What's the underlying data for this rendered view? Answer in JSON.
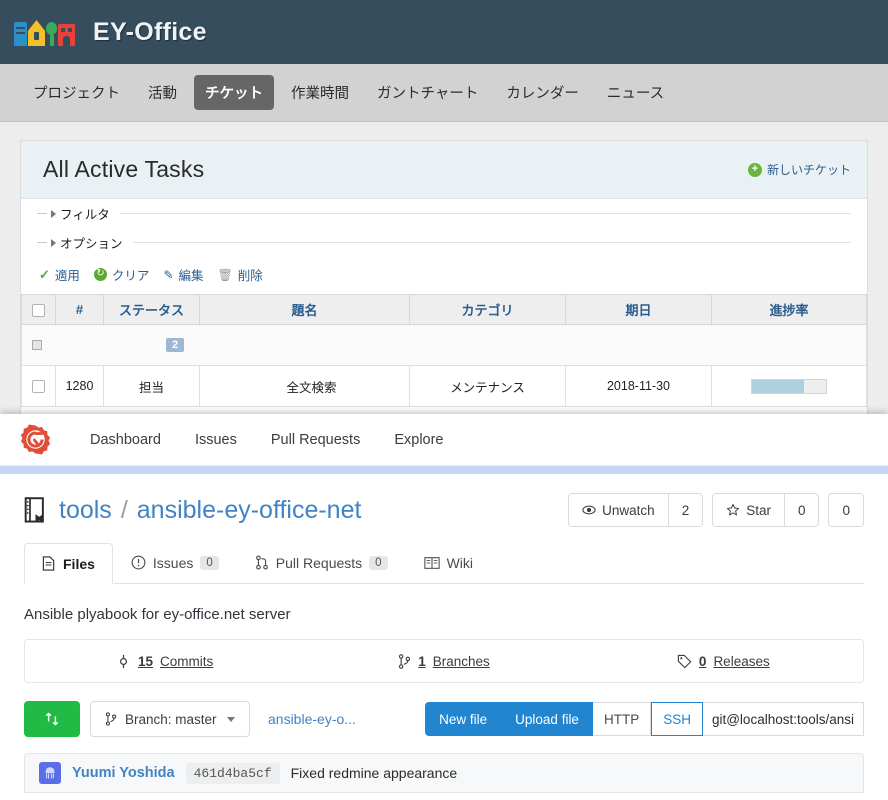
{
  "redmine": {
    "brand": "EY-Office",
    "logo_icon": "houses-logo-icon",
    "nav": [
      {
        "label": "プロジェクト",
        "active": false
      },
      {
        "label": "活動",
        "active": false
      },
      {
        "label": "チケット",
        "active": true
      },
      {
        "label": "作業時間",
        "active": false
      },
      {
        "label": "ガントチャート",
        "active": false
      },
      {
        "label": "カレンダー",
        "active": false
      },
      {
        "label": "ニュース",
        "active": false
      }
    ],
    "page_title": "All Active Tasks",
    "new_ticket_label": "新しいチケット",
    "new_ticket_icon": "plus-circle-icon",
    "collapsibles": [
      {
        "label": "フィルタ"
      },
      {
        "label": "オプション"
      }
    ],
    "tools": [
      {
        "label": "適用",
        "icon": "check-icon"
      },
      {
        "label": "クリア",
        "icon": "reload-icon"
      },
      {
        "label": "編集",
        "icon": "pencil-icon"
      },
      {
        "label": "削除",
        "icon": "trash-icon"
      }
    ],
    "table": {
      "headers": [
        "#",
        "ステータス",
        "題名",
        "カテゴリ",
        "期日",
        "進捗率"
      ],
      "group_row": {
        "name_redacted": true,
        "count": "2"
      },
      "rows": [
        {
          "id": "1280",
          "status": "担当",
          "subject": "全文検索",
          "category": "メンテナンス",
          "due_date": "2018-11-30",
          "progress_percent": 70
        }
      ]
    }
  },
  "gitea": {
    "logo_icon": "gitea-gear-icon",
    "nav": [
      {
        "label": "Dashboard"
      },
      {
        "label": "Issues"
      },
      {
        "label": "Pull Requests"
      },
      {
        "label": "Explore"
      }
    ],
    "repo": {
      "icon": "repo-book-icon",
      "owner": "tools",
      "separator": "/",
      "name": "ansible-ey-office-net",
      "watch": {
        "label": "Unwatch",
        "icon": "eye-icon",
        "count": "2"
      },
      "star": {
        "label": "Star",
        "icon": "star-icon",
        "count": "0"
      },
      "fork": {
        "count": "0"
      }
    },
    "tabs": [
      {
        "label": "Files",
        "icon": "file-icon",
        "badge": "",
        "active": true
      },
      {
        "label": "Issues",
        "icon": "issue-circle-icon",
        "badge": "0",
        "active": false
      },
      {
        "label": "Pull Requests",
        "icon": "pull-request-icon",
        "badge": "0",
        "active": false
      },
      {
        "label": "Wiki",
        "icon": "book-icon",
        "badge": "",
        "active": false
      }
    ],
    "description": "Ansible plyabook for ey-office.net server",
    "stats": [
      {
        "icon": "commit-icon",
        "count": "15",
        "label": "Commits"
      },
      {
        "icon": "branch-icon",
        "count": "1",
        "label": "Branches"
      },
      {
        "icon": "tag-icon",
        "count": "0",
        "label": "Releases"
      }
    ],
    "file_toolbar": {
      "sync_icon": "compare-icon",
      "branch_icon": "branch-icon",
      "branch_label": "Branch: master",
      "breadcrumb": "ansible-ey-o...",
      "new_file_label": "New file",
      "upload_file_label": "Upload file",
      "protocol_http": "HTTP",
      "protocol_ssh": "SSH",
      "active_protocol": "SSH",
      "clone_url": "git@localhost:tools/ansi"
    },
    "latest_commit": {
      "avatar_icon": "user-avatar",
      "author": "Yuumi Yoshida",
      "hash": "461d4ba5cf",
      "message": "Fixed redmine appearance"
    }
  },
  "colors": {
    "redmine_header": "#364d5e",
    "gitea_accent": "#4183c4",
    "gitea_logo": "#e04e39",
    "green_button": "#21ba45",
    "blue_button": "#2185d0",
    "progress_fill": "#aecfdd"
  }
}
